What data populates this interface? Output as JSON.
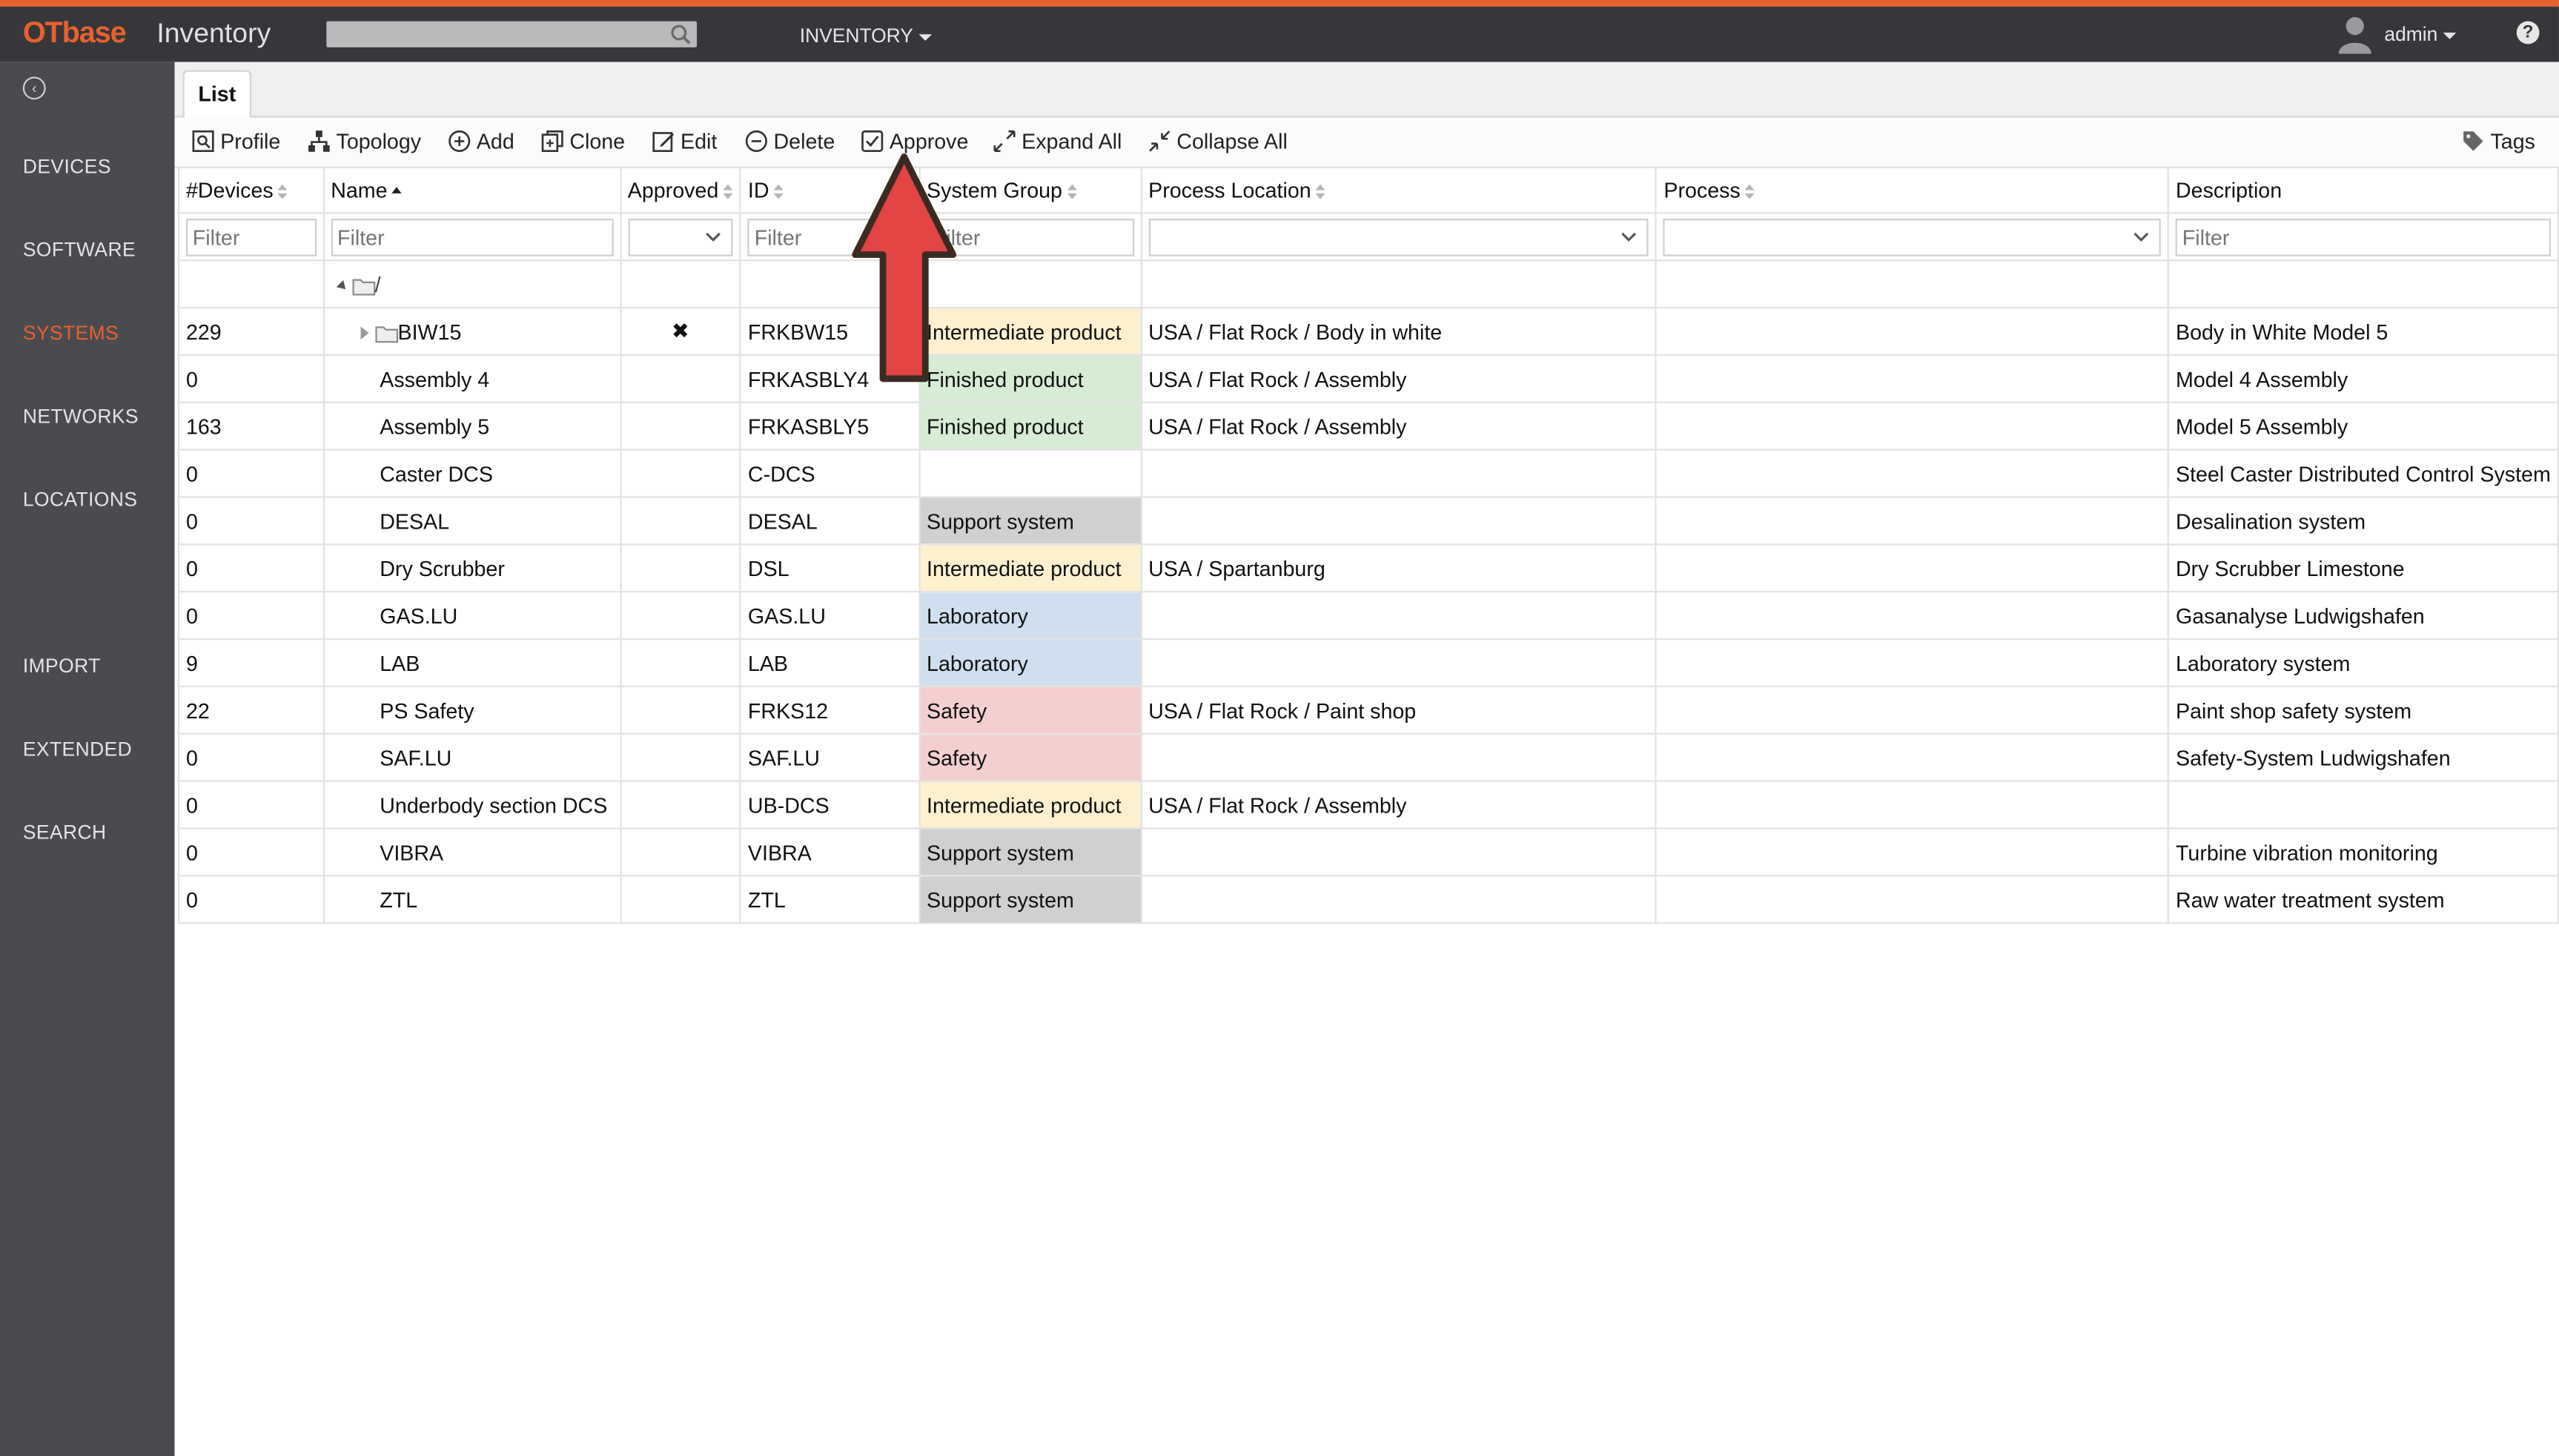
{
  "header": {
    "logo_ot": "OT",
    "logo_base": "base",
    "app_name": "Inventory",
    "menu_label": "INVENTORY",
    "user_label": "admin",
    "help_label": "?"
  },
  "sidebar": {
    "items": [
      {
        "label": "DEVICES"
      },
      {
        "label": "SOFTWARE"
      },
      {
        "label": "SYSTEMS",
        "active": true
      },
      {
        "label": "NETWORKS"
      },
      {
        "label": "LOCATIONS"
      },
      {
        "label": "IMPORT"
      },
      {
        "label": "EXTENDED"
      },
      {
        "label": "SEARCH"
      }
    ]
  },
  "tabs": {
    "list": "List"
  },
  "toolbar": {
    "profile": "Profile",
    "topology": "Topology",
    "add": "Add",
    "clone": "Clone",
    "edit": "Edit",
    "delete": "Delete",
    "approve": "Approve",
    "expand_all": "Expand All",
    "collapse_all": "Collapse All",
    "tags": "Tags"
  },
  "columns": {
    "devices": "#Devices",
    "name": "Name",
    "approved": "Approved",
    "id": "ID",
    "system_group": "System Group",
    "process_location": "Process Location",
    "process": "Process",
    "description": "Description"
  },
  "filter_placeholder": "Filter",
  "tree_root": "/",
  "rows": [
    {
      "devices": "229",
      "name": "BIW15",
      "approved": "✖",
      "id": "FRKBW15",
      "group": "Intermediate product",
      "location": "USA / Flat Rock / Body in white",
      "process": "",
      "description": "Body in White Model 5"
    },
    {
      "devices": "0",
      "name": "Assembly 4",
      "approved": "",
      "id": "FRKASBLY4",
      "group": "Finished product",
      "location": "USA / Flat Rock / Assembly",
      "process": "",
      "description": "Model 4 Assembly"
    },
    {
      "devices": "163",
      "name": "Assembly 5",
      "approved": "",
      "id": "FRKASBLY5",
      "group": "Finished product",
      "location": "USA / Flat Rock / Assembly",
      "process": "",
      "description": "Model 5 Assembly"
    },
    {
      "devices": "0",
      "name": "Caster DCS",
      "approved": "",
      "id": "C-DCS",
      "group": "",
      "location": "",
      "process": "",
      "description": "Steel Caster Distributed Control System"
    },
    {
      "devices": "0",
      "name": "DESAL",
      "approved": "",
      "id": "DESAL",
      "group": "Support system",
      "location": "",
      "process": "",
      "description": "Desalination system"
    },
    {
      "devices": "0",
      "name": "Dry Scrubber",
      "approved": "",
      "id": "DSL",
      "group": "Intermediate product",
      "location": "USA / Spartanburg",
      "process": "",
      "description": "Dry Scrubber Limestone"
    },
    {
      "devices": "0",
      "name": "GAS.LU",
      "approved": "",
      "id": "GAS.LU",
      "group": "Laboratory",
      "location": "",
      "process": "",
      "description": "Gasanalyse Ludwigshafen"
    },
    {
      "devices": "9",
      "name": "LAB",
      "approved": "",
      "id": "LAB",
      "group": "Laboratory",
      "location": "",
      "process": "",
      "description": "Laboratory system"
    },
    {
      "devices": "22",
      "name": "PS Safety",
      "approved": "",
      "id": "FRKS12",
      "group": "Safety",
      "location": "USA / Flat Rock / Paint shop",
      "process": "",
      "description": "Paint shop safety system"
    },
    {
      "devices": "0",
      "name": "SAF.LU",
      "approved": "",
      "id": "SAF.LU",
      "group": "Safety",
      "location": "",
      "process": "",
      "description": "Safety-System Ludwigshafen"
    },
    {
      "devices": "0",
      "name": "Underbody section DCS",
      "approved": "",
      "id": "UB-DCS",
      "group": "Intermediate product",
      "location": "USA / Flat Rock / Assembly",
      "process": "",
      "description": ""
    },
    {
      "devices": "0",
      "name": "VIBRA",
      "approved": "",
      "id": "VIBRA",
      "group": "Support system",
      "location": "",
      "process": "",
      "description": "Turbine vibration monitoring"
    },
    {
      "devices": "0",
      "name": "ZTL",
      "approved": "",
      "id": "ZTL",
      "group": "Support system",
      "location": "",
      "process": "",
      "description": "Raw water treatment system"
    }
  ],
  "group_colors": {
    "Intermediate product": "#fcf0cf",
    "Finished product": "#d6ecd4",
    "Support system": "#d0d0d0",
    "Laboratory": "#cfdff0",
    "Safety": "#f4cfcf"
  },
  "colors": {
    "accent": "#e8612c",
    "arrow": "#e34444",
    "topbar": "#36373b",
    "sidebar": "#4a4b4f"
  }
}
